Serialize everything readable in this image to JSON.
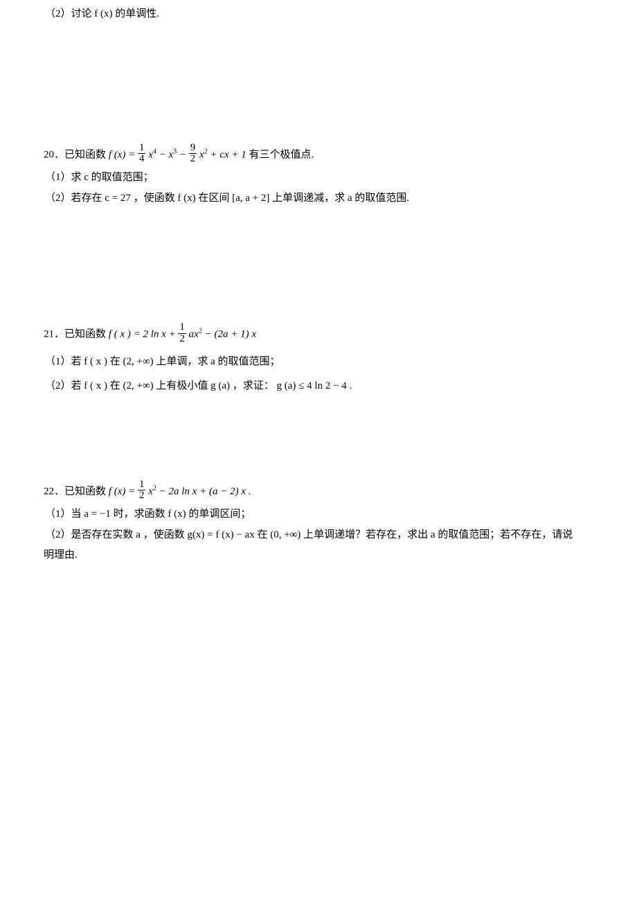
{
  "q19_part2": "（2）讨论 f (x) 的单调性.",
  "q20": {
    "num": "20．",
    "lead": "已知函数 ",
    "func_pre": "f (x) = ",
    "frac1_num": "1",
    "frac1_den": "4",
    "t1": " x",
    "exp4": "4",
    "t2": " − x",
    "exp3": "3",
    "t3": " − ",
    "frac2_num": "9",
    "frac2_den": "2",
    "t4": " x",
    "exp2": "2",
    "t5": " + cx + 1",
    "tail": " 有三个极值点.",
    "part1": "（1）求 c 的取值范围；",
    "part2": "（2）若存在 c = 27 ，使函数 f (x) 在区间 [a, a + 2] 上单调递减，求 a 的取值范围."
  },
  "q21": {
    "num": "21．",
    "lead": "已知函数 ",
    "func_pre": "f ( x ) = 2 ln x + ",
    "frac_num": "1",
    "frac_den": "2",
    "t1": " ax",
    "exp2": "2",
    "t2": " − (2a + 1) x",
    "part1": "（1）若 f ( x ) 在 (2, +∞) 上单调，求 a 的取值范围；",
    "part2": "（2）若 f ( x ) 在 (2, +∞) 上有极小值 g (a) ，求证： g (a) ≤ 4 ln 2 − 4 ."
  },
  "q22": {
    "num": "22．",
    "lead": "已知函数 ",
    "func_pre": "f (x) = ",
    "frac_num": "1",
    "frac_den": "2",
    "t1": " x",
    "exp2": "2",
    "t2": " − 2a ln x + (a − 2) x .",
    "part1": "（1）当 a = −1 时，求函数 f (x) 的单调区间；",
    "part2_a": "（2）是否存在实数 a ，使函数 g(x) = f (x) − ax 在 (0, +∞) 上单调递增？若存在，求出 a 的取值范围；若不存在，请说",
    "part2_b": "明理由."
  }
}
